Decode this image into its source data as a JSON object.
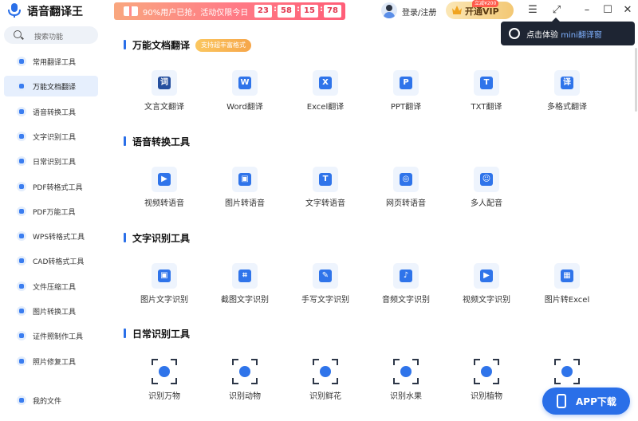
{
  "app": {
    "title": "语音翻译王"
  },
  "promo": {
    "text": "90%用户已抢，活动仅限今日",
    "countdown": [
      "23",
      "58",
      "15",
      "78"
    ]
  },
  "header": {
    "login": "登录/注册",
    "vip_label": "开通VIP",
    "vip_badge": "立减¥200"
  },
  "tooltip": {
    "prefix": "点击体验 ",
    "highlight": "mini翻译窗"
  },
  "search": {
    "placeholder": "搜索功能"
  },
  "sidebar": {
    "items": [
      {
        "label": "常用翻译工具",
        "active": false
      },
      {
        "label": "万能文档翻译",
        "active": true
      },
      {
        "label": "语音转换工具",
        "active": false
      },
      {
        "label": "文字识别工具",
        "active": false
      },
      {
        "label": "日常识别工具",
        "active": false
      },
      {
        "label": "PDF转格式工具",
        "active": false
      },
      {
        "label": "PDF万能工具",
        "active": false
      },
      {
        "label": "WPS转格式工具",
        "active": false
      },
      {
        "label": "CAD转格式工具",
        "active": false
      },
      {
        "label": "文件压缩工具",
        "active": false
      },
      {
        "label": "图片转换工具",
        "active": false
      },
      {
        "label": "证件照制作工具",
        "active": false
      },
      {
        "label": "照片修复工具",
        "active": false
      }
    ],
    "bottom": {
      "label": "我的文件"
    }
  },
  "sections": [
    {
      "title": "万能文档翻译",
      "badge": "支持超丰富格式",
      "tools": [
        {
          "label": "文言文翻译",
          "glyph": "词"
        },
        {
          "label": "Word翻译",
          "glyph": "W"
        },
        {
          "label": "Excel翻译",
          "glyph": "X"
        },
        {
          "label": "PPT翻译",
          "glyph": "P"
        },
        {
          "label": "TXT翻译",
          "glyph": "T"
        },
        {
          "label": "多格式翻译",
          "glyph": "译"
        }
      ]
    },
    {
      "title": "语音转换工具",
      "tools": [
        {
          "label": "视频转语音",
          "glyph": "▶"
        },
        {
          "label": "图片转语音",
          "glyph": "▣"
        },
        {
          "label": "文字转语音",
          "glyph": "T"
        },
        {
          "label": "网页转语音",
          "glyph": "◎"
        },
        {
          "label": "多人配音",
          "glyph": "☺"
        }
      ]
    },
    {
      "title": "文字识别工具",
      "tools": [
        {
          "label": "图片文字识别",
          "glyph": "▣"
        },
        {
          "label": "截图文字识别",
          "glyph": "⌗"
        },
        {
          "label": "手写文字识别",
          "glyph": "✎"
        },
        {
          "label": "音频文字识别",
          "glyph": "♪"
        },
        {
          "label": "视频文字识别",
          "glyph": "▶"
        },
        {
          "label": "图片转Excel",
          "glyph": "▦"
        }
      ]
    },
    {
      "title": "日常识别工具",
      "tools": [
        {
          "label": "识别万物",
          "glyph": "scan"
        },
        {
          "label": "识别动物",
          "glyph": "scan"
        },
        {
          "label": "识别鲜花",
          "glyph": "scan"
        },
        {
          "label": "识别水果",
          "glyph": "scan"
        },
        {
          "label": "识别植物",
          "glyph": "scan"
        },
        {
          "label": "",
          "glyph": "scan"
        }
      ]
    }
  ],
  "app_download": {
    "label": "APP下载"
  }
}
